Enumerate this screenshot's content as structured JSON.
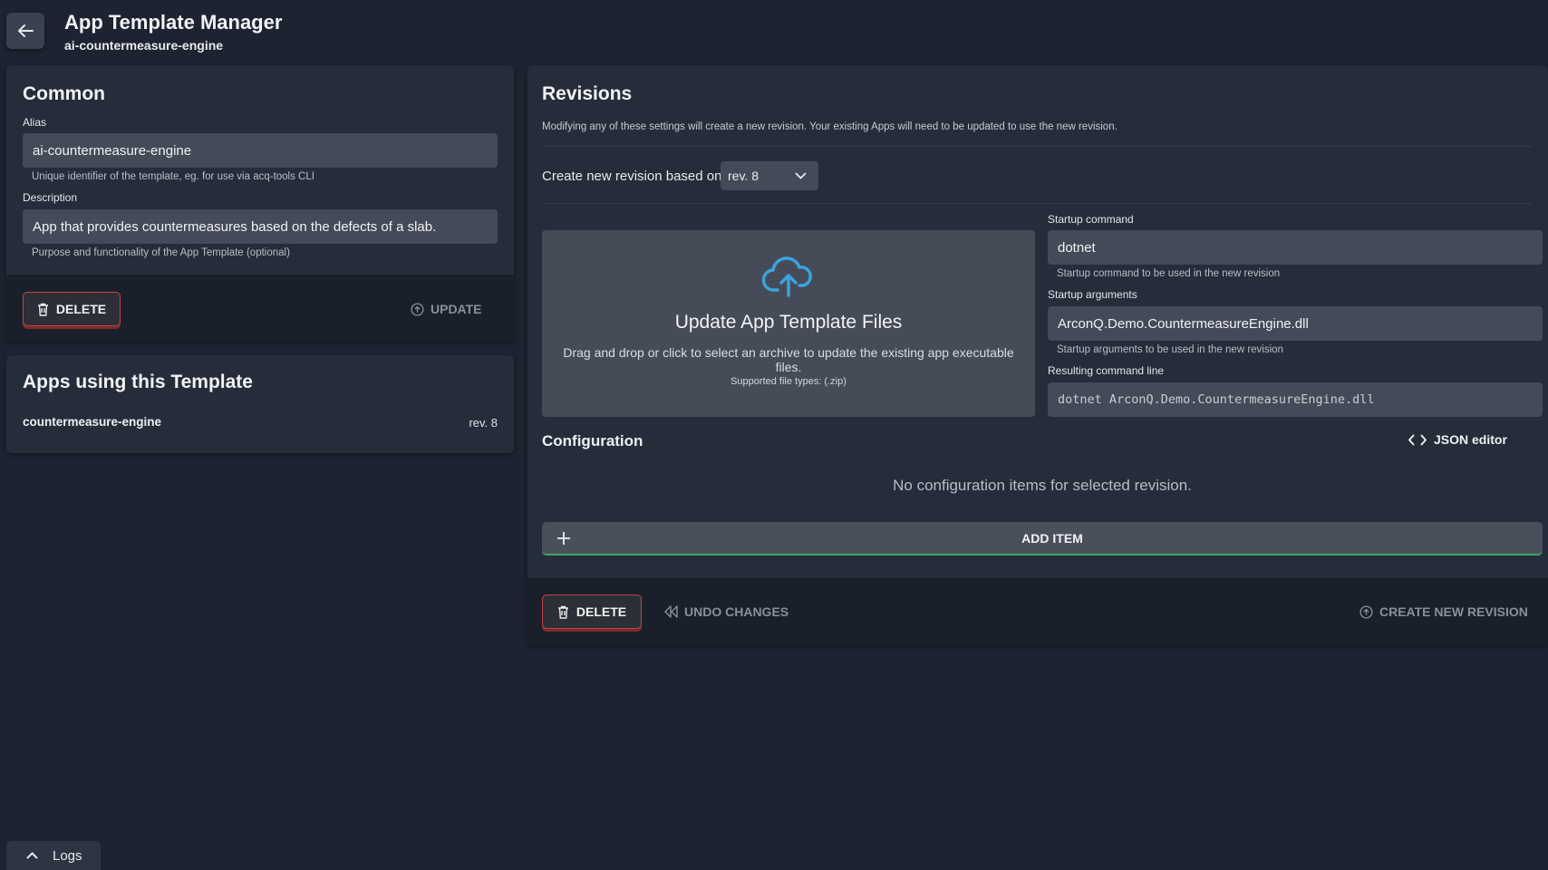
{
  "header": {
    "title": "App Template Manager",
    "subtitle": "ai-countermeasure-engine"
  },
  "common": {
    "title": "Common",
    "alias_label": "Alias",
    "alias_value": "ai-countermeasure-engine",
    "alias_hint": "Unique identifier of the template, eg. for use via acq-tools CLI",
    "description_label": "Description",
    "description_value": "App that provides countermeasures based on the defects of a slab.",
    "description_hint": "Purpose and functionality of the App Template (optional)",
    "delete_label": "DELETE",
    "update_label": "UPDATE"
  },
  "apps": {
    "title": "Apps using this Template",
    "items": [
      {
        "name": "countermeasure-engine",
        "revision": "rev. 8"
      }
    ]
  },
  "revisions": {
    "title": "Revisions",
    "notice": "Modifying any of these settings will create a new revision. Your existing Apps will need to be updated to use the new revision.",
    "based_on_label": "Create new revision based on",
    "based_on_value": "rev. 8",
    "upload": {
      "title": "Update App Template Files",
      "text": "Drag and drop or click to select an archive to update the existing app executable files.",
      "types": "Supported file types: (.zip)"
    },
    "startup_command_label": "Startup command",
    "startup_command_value": "dotnet",
    "startup_command_hint": "Startup command to be used in the new revision",
    "startup_args_label": "Startup arguments",
    "startup_args_value": "ArconQ.Demo.CountermeasureEngine.dll",
    "startup_args_hint": "Startup arguments to be used in the new revision",
    "result_label": "Resulting command line",
    "result_value": "dotnet ArconQ.Demo.CountermeasureEngine.dll",
    "configuration_title": "Configuration",
    "json_editor_label": "JSON editor",
    "empty_text": "No configuration items for selected revision.",
    "add_item_label": "ADD ITEM",
    "delete_label": "DELETE",
    "undo_label": "UNDO CHANGES",
    "create_label": "CREATE NEW REVISION"
  },
  "logs": {
    "label": "Logs"
  },
  "colors": {
    "background": "#1d2330",
    "card": "#262d3a",
    "accent_blue": "#3ba4e0",
    "danger": "#c24444",
    "success": "#3fa659"
  },
  "icons": {
    "back": "arrow-left-icon",
    "delete": "trash-icon",
    "update": "arrow-up-circle-icon",
    "upload": "cloud-upload-icon",
    "dropdown": "chevron-down-icon",
    "json": "code-brackets-icon",
    "add": "plus-icon",
    "undo": "rewind-icon",
    "create": "arrow-up-circle-icon",
    "logs": "chevron-up-icon"
  }
}
